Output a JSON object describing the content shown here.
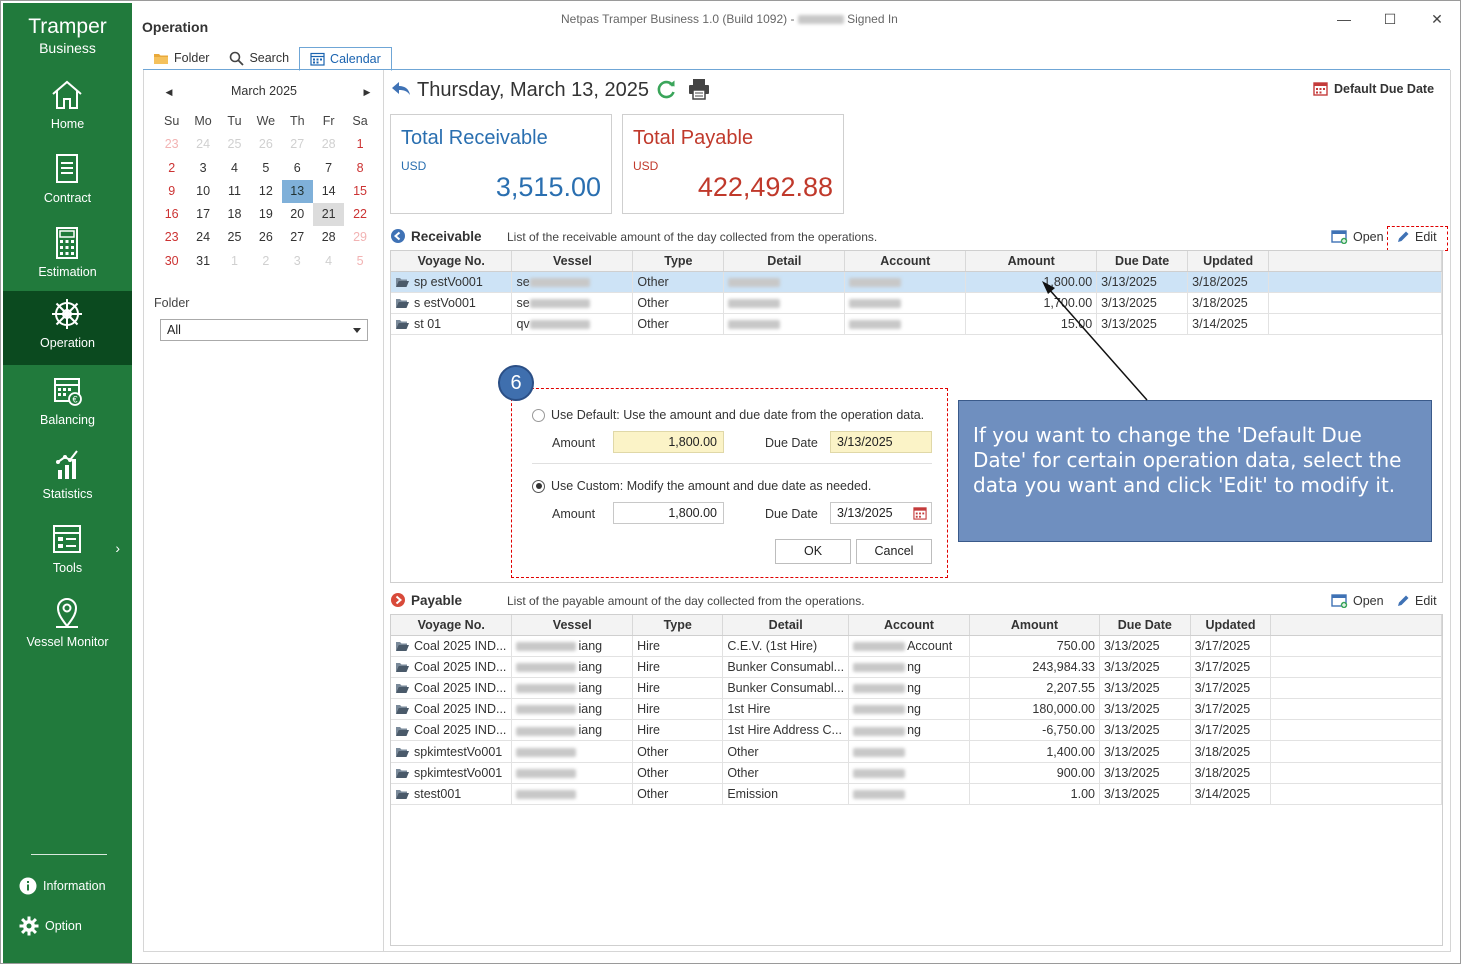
{
  "app": {
    "brand_line1": "Tramper",
    "brand_line2": "Business",
    "title_prefix": "Netpas Tramper Business 1.0 (Build 1092) -",
    "title_suffix": "Signed In"
  },
  "sidebar": {
    "items": [
      {
        "label": "Home",
        "icon": "home-icon"
      },
      {
        "label": "Contract",
        "icon": "document-icon"
      },
      {
        "label": "Estimation",
        "icon": "calculator-icon"
      },
      {
        "label": "Operation",
        "icon": "ship-wheel-icon",
        "active": true
      },
      {
        "label": "Balancing",
        "icon": "balance-calendar-icon"
      },
      {
        "label": "Statistics",
        "icon": "chart-icon"
      },
      {
        "label": "Tools",
        "icon": "toolbox-icon"
      },
      {
        "label": "Vessel Monitor",
        "icon": "location-pin-icon"
      }
    ],
    "information": "Information",
    "option": "Option"
  },
  "section_title": "Operation",
  "tabs": [
    "Folder",
    "Search",
    "Calendar"
  ],
  "calendar": {
    "month_label": "March 2025",
    "weekdays": [
      "Su",
      "Mo",
      "Tu",
      "We",
      "Th",
      "Fr",
      "Sa"
    ],
    "weeks": [
      [
        "23",
        "24",
        "25",
        "26",
        "27",
        "28",
        "1"
      ],
      [
        "2",
        "3",
        "4",
        "5",
        "6",
        "7",
        "8"
      ],
      [
        "9",
        "10",
        "11",
        "12",
        "13",
        "14",
        "15"
      ],
      [
        "16",
        "17",
        "18",
        "19",
        "20",
        "21",
        "22"
      ],
      [
        "23",
        "24",
        "25",
        "26",
        "27",
        "28",
        "29"
      ],
      [
        "30",
        "31",
        "1",
        "2",
        "3",
        "4",
        "5"
      ]
    ],
    "selected": "13",
    "today": "21"
  },
  "folder": {
    "label": "Folder",
    "value": "All"
  },
  "header": {
    "date": "Thursday, March 13, 2025",
    "default_due_date": "Default Due Date"
  },
  "totals": {
    "receivable": {
      "title": "Total Receivable",
      "currency": "USD",
      "value": "3,515.00",
      "color": "#2a6fb0"
    },
    "payable": {
      "title": "Total Payable",
      "currency": "USD",
      "value": "422,492.88",
      "color": "#c0392b"
    }
  },
  "receivable": {
    "title": "Receivable",
    "description": "List of the receivable amount of the day collected from the operations.",
    "open": "Open",
    "edit": "Edit",
    "columns": [
      "Voyage No.",
      "Vessel",
      "Type",
      "Detail",
      "Account",
      "Amount",
      "Due Date",
      "Updated"
    ],
    "rows": [
      {
        "voyage": "sp  estVo001",
        "vessel": "se",
        "type": "Other",
        "detail": "",
        "account": "",
        "amount": "1,800.00",
        "due": "3/13/2025",
        "updated": "3/18/2025"
      },
      {
        "voyage": "s  estVo001",
        "vessel": "se",
        "type": "Other",
        "detail": "",
        "account": "",
        "amount": "1,700.00",
        "due": "3/13/2025",
        "updated": "3/18/2025"
      },
      {
        "voyage": "st  01",
        "vessel": "qv",
        "type": "Other",
        "detail": "",
        "account": "",
        "amount": "15.00",
        "due": "3/13/2025",
        "updated": "3/14/2025"
      }
    ]
  },
  "payable": {
    "title": "Payable",
    "description": "List of the payable amount of the day collected from the operations.",
    "open": "Open",
    "edit": "Edit",
    "columns": [
      "Voyage No.",
      "Vessel",
      "Type",
      "Detail",
      "Account",
      "Amount",
      "Due Date",
      "Updated"
    ],
    "rows": [
      {
        "voyage": "Coal 2025 IND...",
        "vessel": "iang",
        "type": "Hire",
        "detail": "C.E.V. (1st Hire)",
        "account": "Account",
        "amount": "750.00",
        "due": "3/13/2025",
        "updated": "3/17/2025"
      },
      {
        "voyage": "Coal 2025 IND...",
        "vessel": "iang",
        "type": "Hire",
        "detail": "Bunker Consumabl...",
        "account": "ng",
        "amount": "243,984.33",
        "due": "3/13/2025",
        "updated": "3/17/2025"
      },
      {
        "voyage": "Coal 2025 IND...",
        "vessel": "iang",
        "type": "Hire",
        "detail": "Bunker Consumabl...",
        "account": "ng",
        "amount": "2,207.55",
        "due": "3/13/2025",
        "updated": "3/17/2025"
      },
      {
        "voyage": "Coal 2025 IND...",
        "vessel": "iang",
        "type": "Hire",
        "detail": "1st Hire",
        "account": "ng",
        "amount": "180,000.00",
        "due": "3/13/2025",
        "updated": "3/17/2025"
      },
      {
        "voyage": "Coal 2025 IND...",
        "vessel": "iang",
        "type": "Hire",
        "detail": "1st Hire Address C...",
        "account": "ng",
        "amount": "-6,750.00",
        "due": "3/13/2025",
        "updated": "3/17/2025"
      },
      {
        "voyage": "spkimtestVo001",
        "vessel": "",
        "type": "Other",
        "detail": "Other",
        "account": "",
        "amount": "1,400.00",
        "due": "3/13/2025",
        "updated": "3/18/2025"
      },
      {
        "voyage": "spkimtestVo001",
        "vessel": "",
        "type": "Other",
        "detail": "Other",
        "account": "",
        "amount": "900.00",
        "due": "3/13/2025",
        "updated": "3/18/2025"
      },
      {
        "voyage": "stest001",
        "vessel": "",
        "type": "Other",
        "detail": "Emission",
        "account": "",
        "amount": "1.00",
        "due": "3/13/2025",
        "updated": "3/14/2025"
      }
    ]
  },
  "dialog": {
    "step": "6",
    "default_option": "Use Default: Use the amount and due date from the operation data.",
    "custom_option": "Use Custom: Modify the amount and due date as needed.",
    "amount_label": "Amount",
    "due_label": "Due Date",
    "default_amount": "1,800.00",
    "default_due": "3/13/2025",
    "custom_amount": "1,800.00",
    "custom_due": "3/13/2025",
    "ok": "OK",
    "cancel": "Cancel"
  },
  "callout": {
    "text": "If you want to change the 'Default Due Date' for certain operation data, select the data you want and click 'Edit' to modify it."
  },
  "colors": {
    "sidebar": "#217a3c",
    "sidebar_active": "#0b4a1f",
    "accent_blue": "#1a63b0",
    "highlight_red": "#e00000",
    "callout": "#6f8fbf"
  }
}
